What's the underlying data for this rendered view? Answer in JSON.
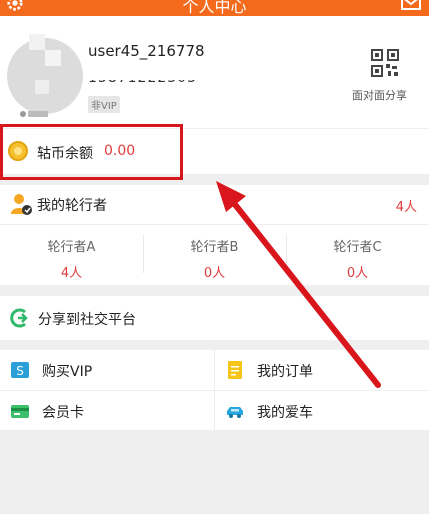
{
  "header": {
    "title": "个人中心"
  },
  "profile": {
    "username": "user45_216778",
    "phone": "15871222303",
    "vip_badge": "非VIP",
    "qr_label": "面对面分享"
  },
  "balance": {
    "label": "轱币余额",
    "value": "0.00"
  },
  "riders": {
    "title": "我的轮行者",
    "count": "4人",
    "columns": [
      {
        "name": "轮行者A",
        "value": "4人"
      },
      {
        "name": "轮行者B",
        "value": "0人"
      },
      {
        "name": "轮行者C",
        "value": "0人"
      }
    ]
  },
  "share": {
    "label": "分享到社交平台"
  },
  "menu": {
    "buy_vip": "购买VIP",
    "orders": "我的订单",
    "member_card": "会员卡",
    "my_car": "我的爱车"
  },
  "colors": {
    "brand": "#f46a1d",
    "accent": "#e23b3b",
    "annotation": "#d8161b"
  }
}
